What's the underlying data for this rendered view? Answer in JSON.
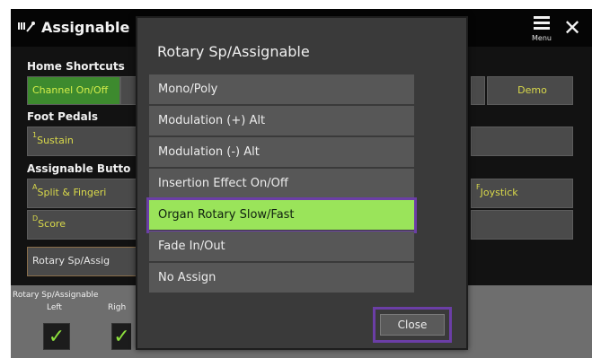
{
  "header": {
    "title": "Assignable",
    "menu_label": "Menu",
    "close_glyph": "✕"
  },
  "background": {
    "home_shortcuts_title": "Home Shortcuts",
    "home_shortcuts": [
      "Channel On/Off",
      "Demo"
    ],
    "foot_pedals_title": "Foot Pedals",
    "foot_pedal_1": "Sustain",
    "foot_pedal_1_num": "1",
    "assignable_buttons_title": "Assignable Butto",
    "button_a": "Split & Fingeri",
    "button_a_key": "A",
    "button_d": "Score",
    "button_d_key": "D",
    "button_joystick": "Joystick",
    "button_joystick_key": "F",
    "rotary_button": "Rotary Sp/Assig"
  },
  "bottom_strip": {
    "label": "Rotary Sp/Assignable",
    "left_label": "Left",
    "right_label": "Righ",
    "check_glyph": "✓"
  },
  "dialog": {
    "title": "Rotary Sp/Assignable",
    "options": [
      {
        "label": "Mono/Poly",
        "selected": false
      },
      {
        "label": "Modulation (+) Alt",
        "selected": false
      },
      {
        "label": "Modulation (-) Alt",
        "selected": false
      },
      {
        "label": "Insertion Effect On/Off",
        "selected": false
      },
      {
        "label": "Organ Rotary Slow/Fast",
        "selected": true
      },
      {
        "label": "Fade In/Out",
        "selected": false
      },
      {
        "label": "No Assign",
        "selected": false
      }
    ],
    "close_label": "Close"
  },
  "colors": {
    "selected_item": "#9ae45a",
    "highlight_outline": "#6b3ea6",
    "check_mark": "#8de03d"
  }
}
